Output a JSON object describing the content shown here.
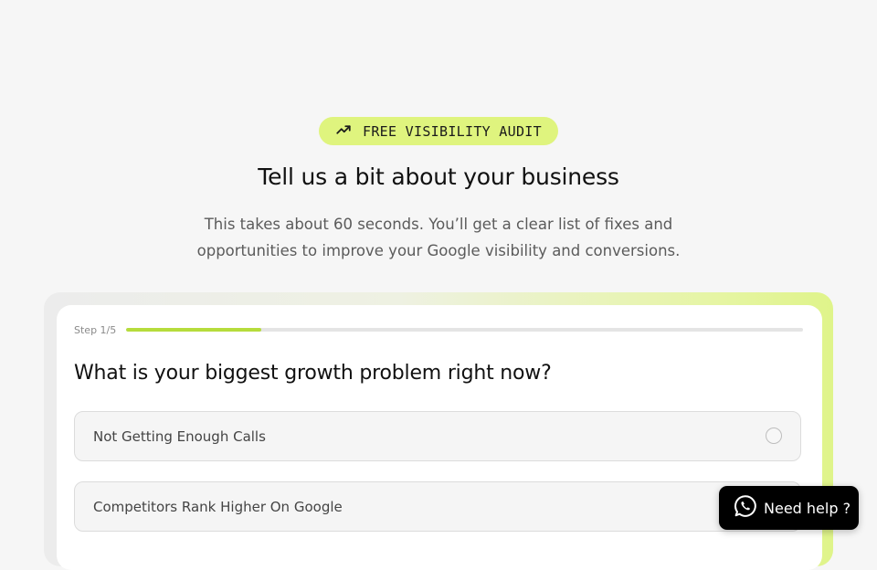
{
  "badge": {
    "icon": "trending-up-icon",
    "label": "FREE VISIBILITY AUDIT"
  },
  "header": {
    "title": "Tell us a bit about your business",
    "subtitle_line1": "This takes about 60 seconds. You’ll get a clear list of fixes and",
    "subtitle_line2": "opportunities to improve your Google visibility and conversions."
  },
  "quiz": {
    "step_label": "Step 1/5",
    "progress": 0.2,
    "question": "What is your biggest growth problem right now?",
    "options": [
      {
        "label": "Not Getting Enough Calls",
        "selected": false
      },
      {
        "label": "Competitors Rank Higher On Google",
        "selected": false
      }
    ]
  },
  "help_button": {
    "icon": "whatsapp-icon",
    "label": "Need help ?"
  },
  "colors": {
    "accent": "#dff47e",
    "progress_fill": "#b6dc3c",
    "background": "#f6f6f6",
    "button_bg": "#000000"
  }
}
